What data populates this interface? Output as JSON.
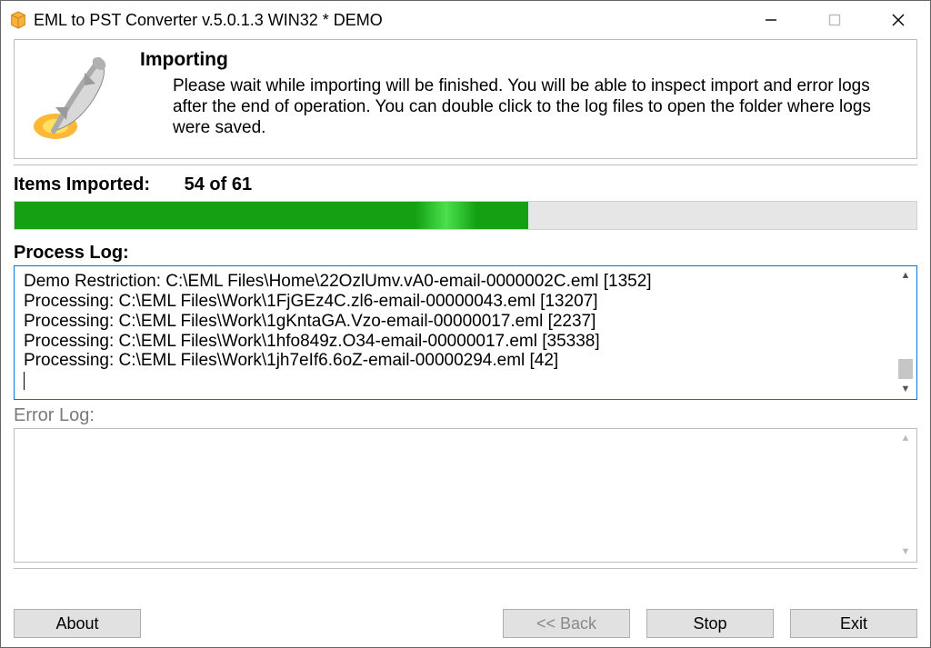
{
  "window": {
    "title": "EML to PST Converter v.5.0.1.3 WIN32 * DEMO"
  },
  "header": {
    "title": "Importing",
    "description": "Please wait while importing will be finished. You will be able to inspect import and error logs after the end of operation. You can double click to the log files to open the folder where logs were saved."
  },
  "progress": {
    "label": "Items Imported:",
    "count_text": "54 of 61",
    "percent": 57
  },
  "process_log": {
    "label": "Process Log:",
    "lines": [
      "Demo Restriction: C:\\EML Files\\Home\\22OzlUmv.vA0-email-0000002C.eml [1352]",
      "Processing: C:\\EML Files\\Work\\1FjGEz4C.zl6-email-00000043.eml [13207]",
      "Processing: C:\\EML Files\\Work\\1gKntaGA.Vzo-email-00000017.eml [2237]",
      "Processing: C:\\EML Files\\Work\\1hfo849z.O34-email-00000017.eml [35338]",
      "Processing: C:\\EML Files\\Work\\1jh7eIf6.6oZ-email-00000294.eml [42]"
    ]
  },
  "error_log": {
    "label": "Error Log:",
    "lines": []
  },
  "buttons": {
    "about": "About",
    "back": "<< Back",
    "stop": "Stop",
    "exit": "Exit"
  }
}
